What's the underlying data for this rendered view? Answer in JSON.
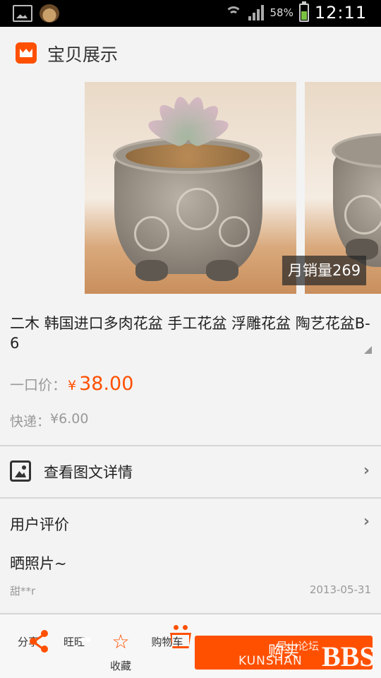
{
  "status_bar": {
    "battery": "58%",
    "time": "12:11"
  },
  "header": {
    "title": "宝贝展示"
  },
  "gallery": {
    "sales_badge": "月销量269"
  },
  "product": {
    "title": "二木 韩国进口多肉花盆 手工花盆 浮雕花盆 陶艺花盆B-6",
    "price_label": "一口价：",
    "price_symbol": "¥",
    "price": "38.00",
    "shipping_label": "快递：",
    "shipping_price": "¥6.00"
  },
  "sections": {
    "details": "查看图文详情",
    "reviews": "用户评价"
  },
  "review": {
    "text": "晒照片~",
    "user": "甜**r",
    "date": "2013-05-31"
  },
  "bottom_bar": {
    "tabs": [
      {
        "label": "分享",
        "icon": "share-icon"
      },
      {
        "label": "旺旺",
        "icon": "wangwang-icon"
      },
      {
        "label": "收藏",
        "icon": "star-icon"
      },
      {
        "label": "购物车",
        "icon": "cart-icon"
      }
    ],
    "buy_label": "购买"
  },
  "watermark": {
    "cn": "昆山论坛",
    "en": "KUNSHAN",
    "bbs": "BBS"
  },
  "colors": {
    "accent": "#ff5000",
    "statusbar": "#000000",
    "background": "#f3f3f3"
  }
}
